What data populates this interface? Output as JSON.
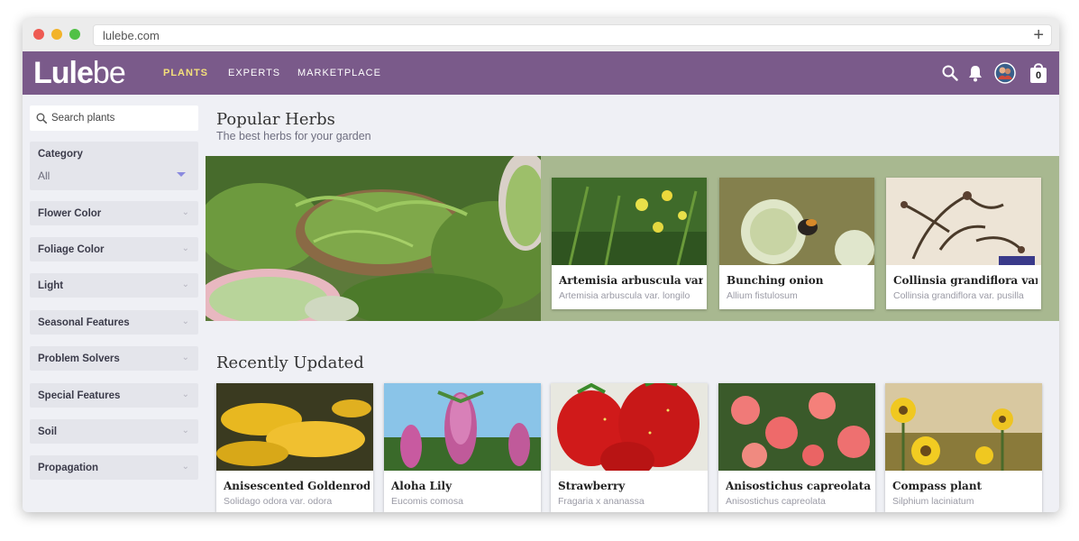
{
  "browser": {
    "url": "lulebe.com",
    "new_tab": "+"
  },
  "nav": {
    "logo_bold": "Lule",
    "logo_thin": "be",
    "items": [
      "PLANTS",
      "EXPERTS",
      "MARKETPLACE"
    ],
    "cart_count": "0",
    "accent": "#7a5a8a",
    "active_color": "#f4e07a"
  },
  "sidebar": {
    "search_placeholder": "Search plants",
    "category": {
      "label": "Category",
      "value": "All"
    },
    "filters": [
      "Flower Color",
      "Foliage Color",
      "Light",
      "Seasonal Features",
      "Problem Solvers",
      "Special Features",
      "Soil",
      "Propagation"
    ]
  },
  "popular": {
    "title": "Popular Herbs",
    "subtitle": "The best herbs for your garden",
    "cards": [
      {
        "title": "Artemisia arbuscula var. l",
        "sci": "Artemisia arbuscula var. longilo"
      },
      {
        "title": "Bunching onion",
        "sci": "Allium fistulosum"
      },
      {
        "title": "Collinsia grandiflora var.",
        "sci": "Collinsia grandiflora var. pusilla"
      }
    ]
  },
  "recent": {
    "title": "Recently Updated",
    "cards": [
      {
        "title": "Anisescented Goldenrod",
        "sci": "Solidago odora var. odora"
      },
      {
        "title": "Aloha Lily",
        "sci": "Eucomis comosa"
      },
      {
        "title": "Strawberry",
        "sci": "Fragaria x ananassa"
      },
      {
        "title": "Anisostichus capreolata",
        "sci": "Anisostichus capreolata"
      },
      {
        "title": "Compass plant",
        "sci": "Silphium laciniatum"
      }
    ]
  }
}
